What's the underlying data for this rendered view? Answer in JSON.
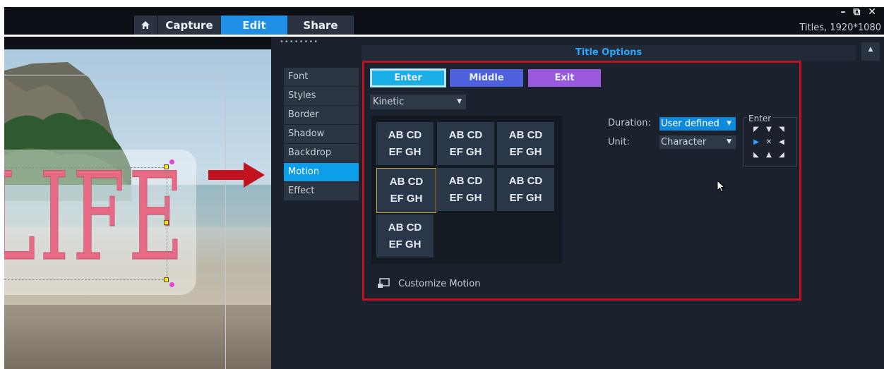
{
  "app": {
    "tabs": [
      {
        "label": "Capture"
      },
      {
        "label": "Edit"
      },
      {
        "label": "Share"
      }
    ],
    "window_controls": "– ⧉ ✕",
    "project_info": "Titles, 1920*1080"
  },
  "preview": {
    "title_text": "LIFE"
  },
  "options": {
    "panel_title": "Title Options",
    "grip": "••••••••",
    "side_nav": [
      "Font",
      "Styles",
      "Border",
      "Shadow",
      "Backdrop",
      "Motion",
      "Effect"
    ],
    "active_nav": "Motion",
    "phase_buttons": {
      "enter": "Enter",
      "middle": "Middle",
      "exit": "Exit"
    },
    "motion_type": "Kinetic",
    "presets": [
      {
        "line1": "AB CD",
        "line2": "EF GH"
      },
      {
        "line1": "AB CD",
        "line2": "EF GH"
      },
      {
        "line1": "AB CD",
        "line2": "EF GH"
      },
      {
        "line1": "AB CD",
        "line2": "EF GH"
      },
      {
        "line1": "AB CD",
        "line2": "EF GH"
      },
      {
        "line1": "AB CD",
        "line2": "EF GH"
      },
      {
        "line1": "AB CD",
        "line2": "EF GH"
      }
    ],
    "selected_preset_index": 3,
    "customize_label": "Customize Motion",
    "duration_label": "Duration:",
    "duration_value": "User defined",
    "unit_label": "Unit:",
    "unit_value": "Character",
    "direction_label": "Enter"
  },
  "colors": {
    "accent": "#1f8fe6",
    "enter": "#1aaee6",
    "middle": "#4d61dd",
    "exit": "#9a5ae0",
    "highlight": "#c0121f",
    "title_text": "#e86b86"
  },
  "icons": {
    "home": "home-icon",
    "customize": "customize-motion-icon",
    "cursor": "mouse-cursor-icon"
  }
}
